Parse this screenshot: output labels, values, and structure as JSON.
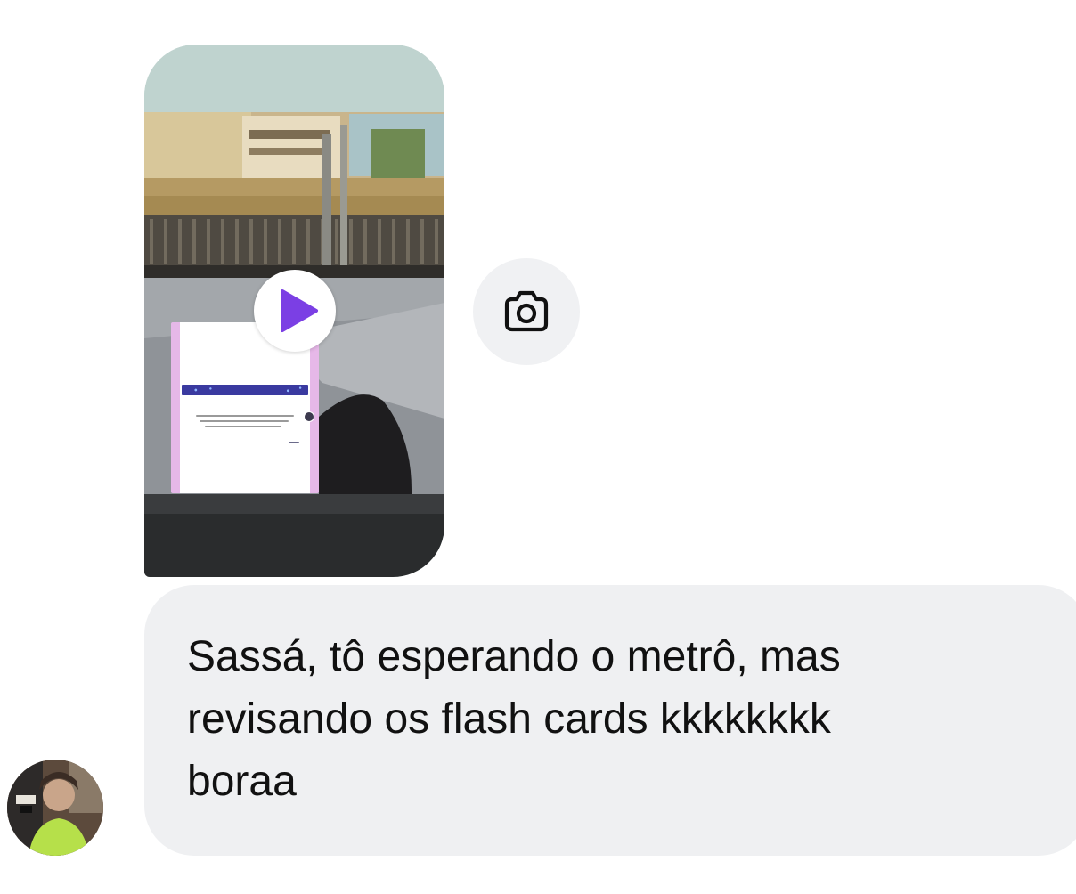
{
  "conversation": {
    "story_reply": {
      "media_type": "video",
      "play_icon": "play-icon",
      "play_color": "#7b3fe4",
      "reply_icon": "camera-icon"
    },
    "message": {
      "text": "Sassá, tô esperando o metrô, mas\nrevisando os flash cards kkkkkkkk\nboraa"
    },
    "sender": {
      "avatar_icon": "profile-photo"
    }
  },
  "colors": {
    "bubble_background": "#eff0f2",
    "camera_button_background": "#f0f1f3",
    "play_accent": "#7b3fe4"
  }
}
